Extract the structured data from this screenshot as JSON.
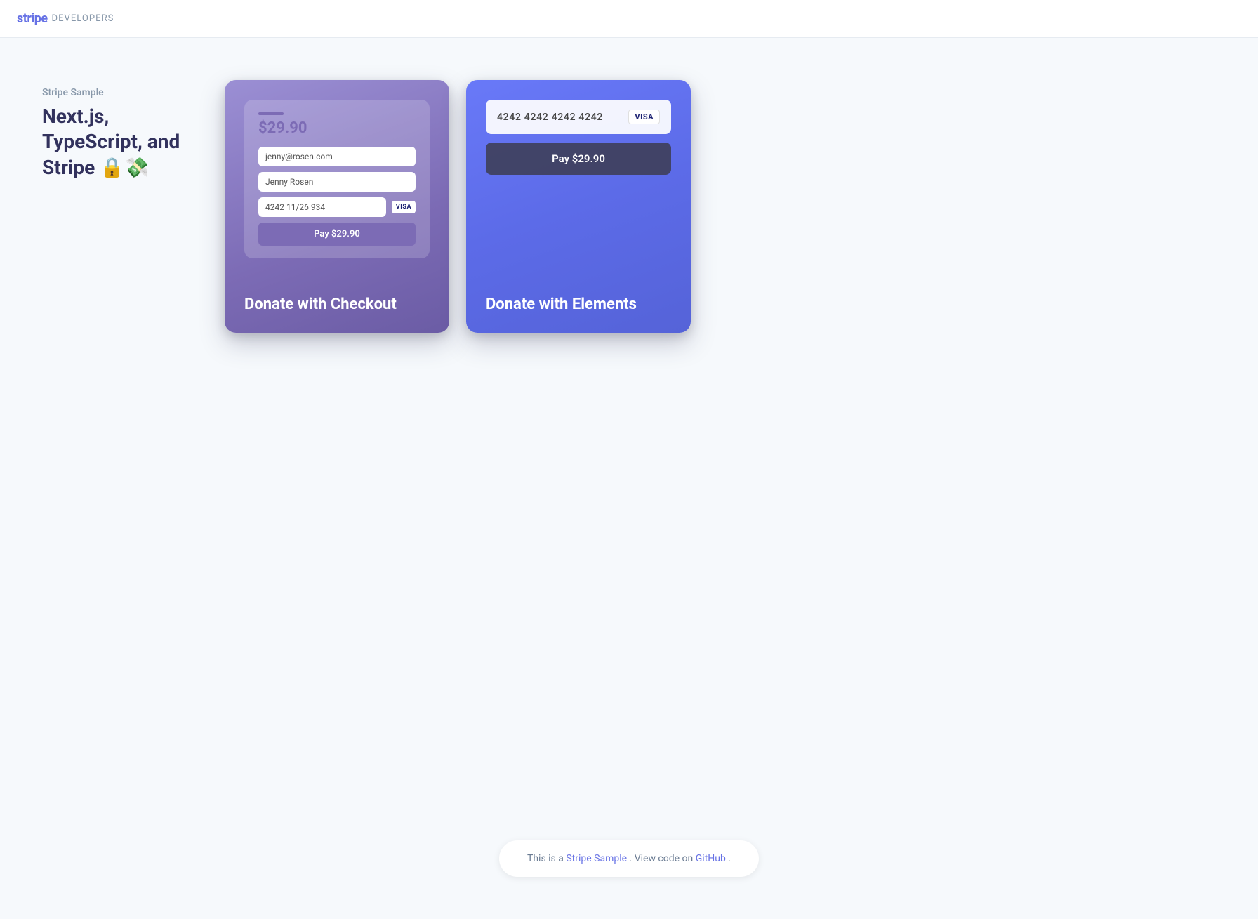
{
  "header": {
    "stripe_label": "stripe",
    "developers_label": "DEVELOPERS"
  },
  "sidebar": {
    "sample_label": "Stripe Sample",
    "title": "Next.js, TypeScript, and Stripe 🔒💸"
  },
  "cards": [
    {
      "id": "checkout",
      "label": "Donate with Checkout",
      "gradient_start": "#9b8fd4",
      "gradient_end": "#6b5ca5",
      "mockup": {
        "amount_bar": true,
        "amount": "$29.90",
        "email": "jenny@rosen.com",
        "name": "Jenny Rosen",
        "card_number": "4242  11/26  934",
        "visa": "VISA",
        "pay_button": "Pay $29.90"
      }
    },
    {
      "id": "elements",
      "label": "Donate with Elements",
      "gradient_start": "#6979f8",
      "gradient_end": "#5563d8",
      "mockup": {
        "card_number": "4242 4242 4242 4242",
        "visa": "VISA",
        "pay_button": "Pay $29.90"
      }
    }
  ],
  "footer": {
    "text_before": "This is a",
    "stripe_sample_label": "Stripe Sample",
    "stripe_sample_url": "#",
    "text_middle": ". View code on",
    "github_label": "GitHub",
    "github_url": "#",
    "text_after": "."
  }
}
